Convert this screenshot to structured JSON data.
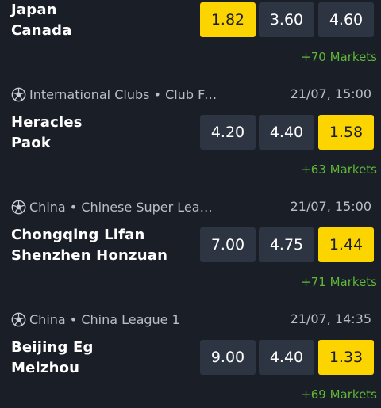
{
  "matches": [
    {
      "league": "",
      "time": "",
      "home": "Japan",
      "away": "Canada",
      "odds": [
        "1.82",
        "3.60",
        "4.60"
      ],
      "highlight": 0,
      "more": "+70 Markets"
    },
    {
      "league": "International Clubs • Club Fri...",
      "time": "21/07, 15:00",
      "home": "Heracles",
      "away": "Paok",
      "odds": [
        "4.20",
        "4.40",
        "1.58"
      ],
      "highlight": 2,
      "more": "+63 Markets"
    },
    {
      "league": "China • Chinese Super League",
      "time": "21/07, 15:00",
      "home": "Chongqing Lifan",
      "away": "Shenzhen Honzuan",
      "odds": [
        "7.00",
        "4.75",
        "1.44"
      ],
      "highlight": 2,
      "more": "+71 Markets"
    },
    {
      "league": "China • China League 1",
      "time": "21/07, 14:35",
      "home": "Beijing Eg",
      "away": "Meizhou",
      "odds": [
        "9.00",
        "4.40",
        "1.33"
      ],
      "highlight": 2,
      "more": "+69 Markets"
    }
  ],
  "colors": {
    "background": "#1a1e27",
    "odd_bg": "#2d3542",
    "odd_highlight": "#fcd400",
    "markets_green": "#5fb836",
    "meta_text": "#b8bfca"
  },
  "icons": {
    "sport": "soccer-ball-icon"
  }
}
